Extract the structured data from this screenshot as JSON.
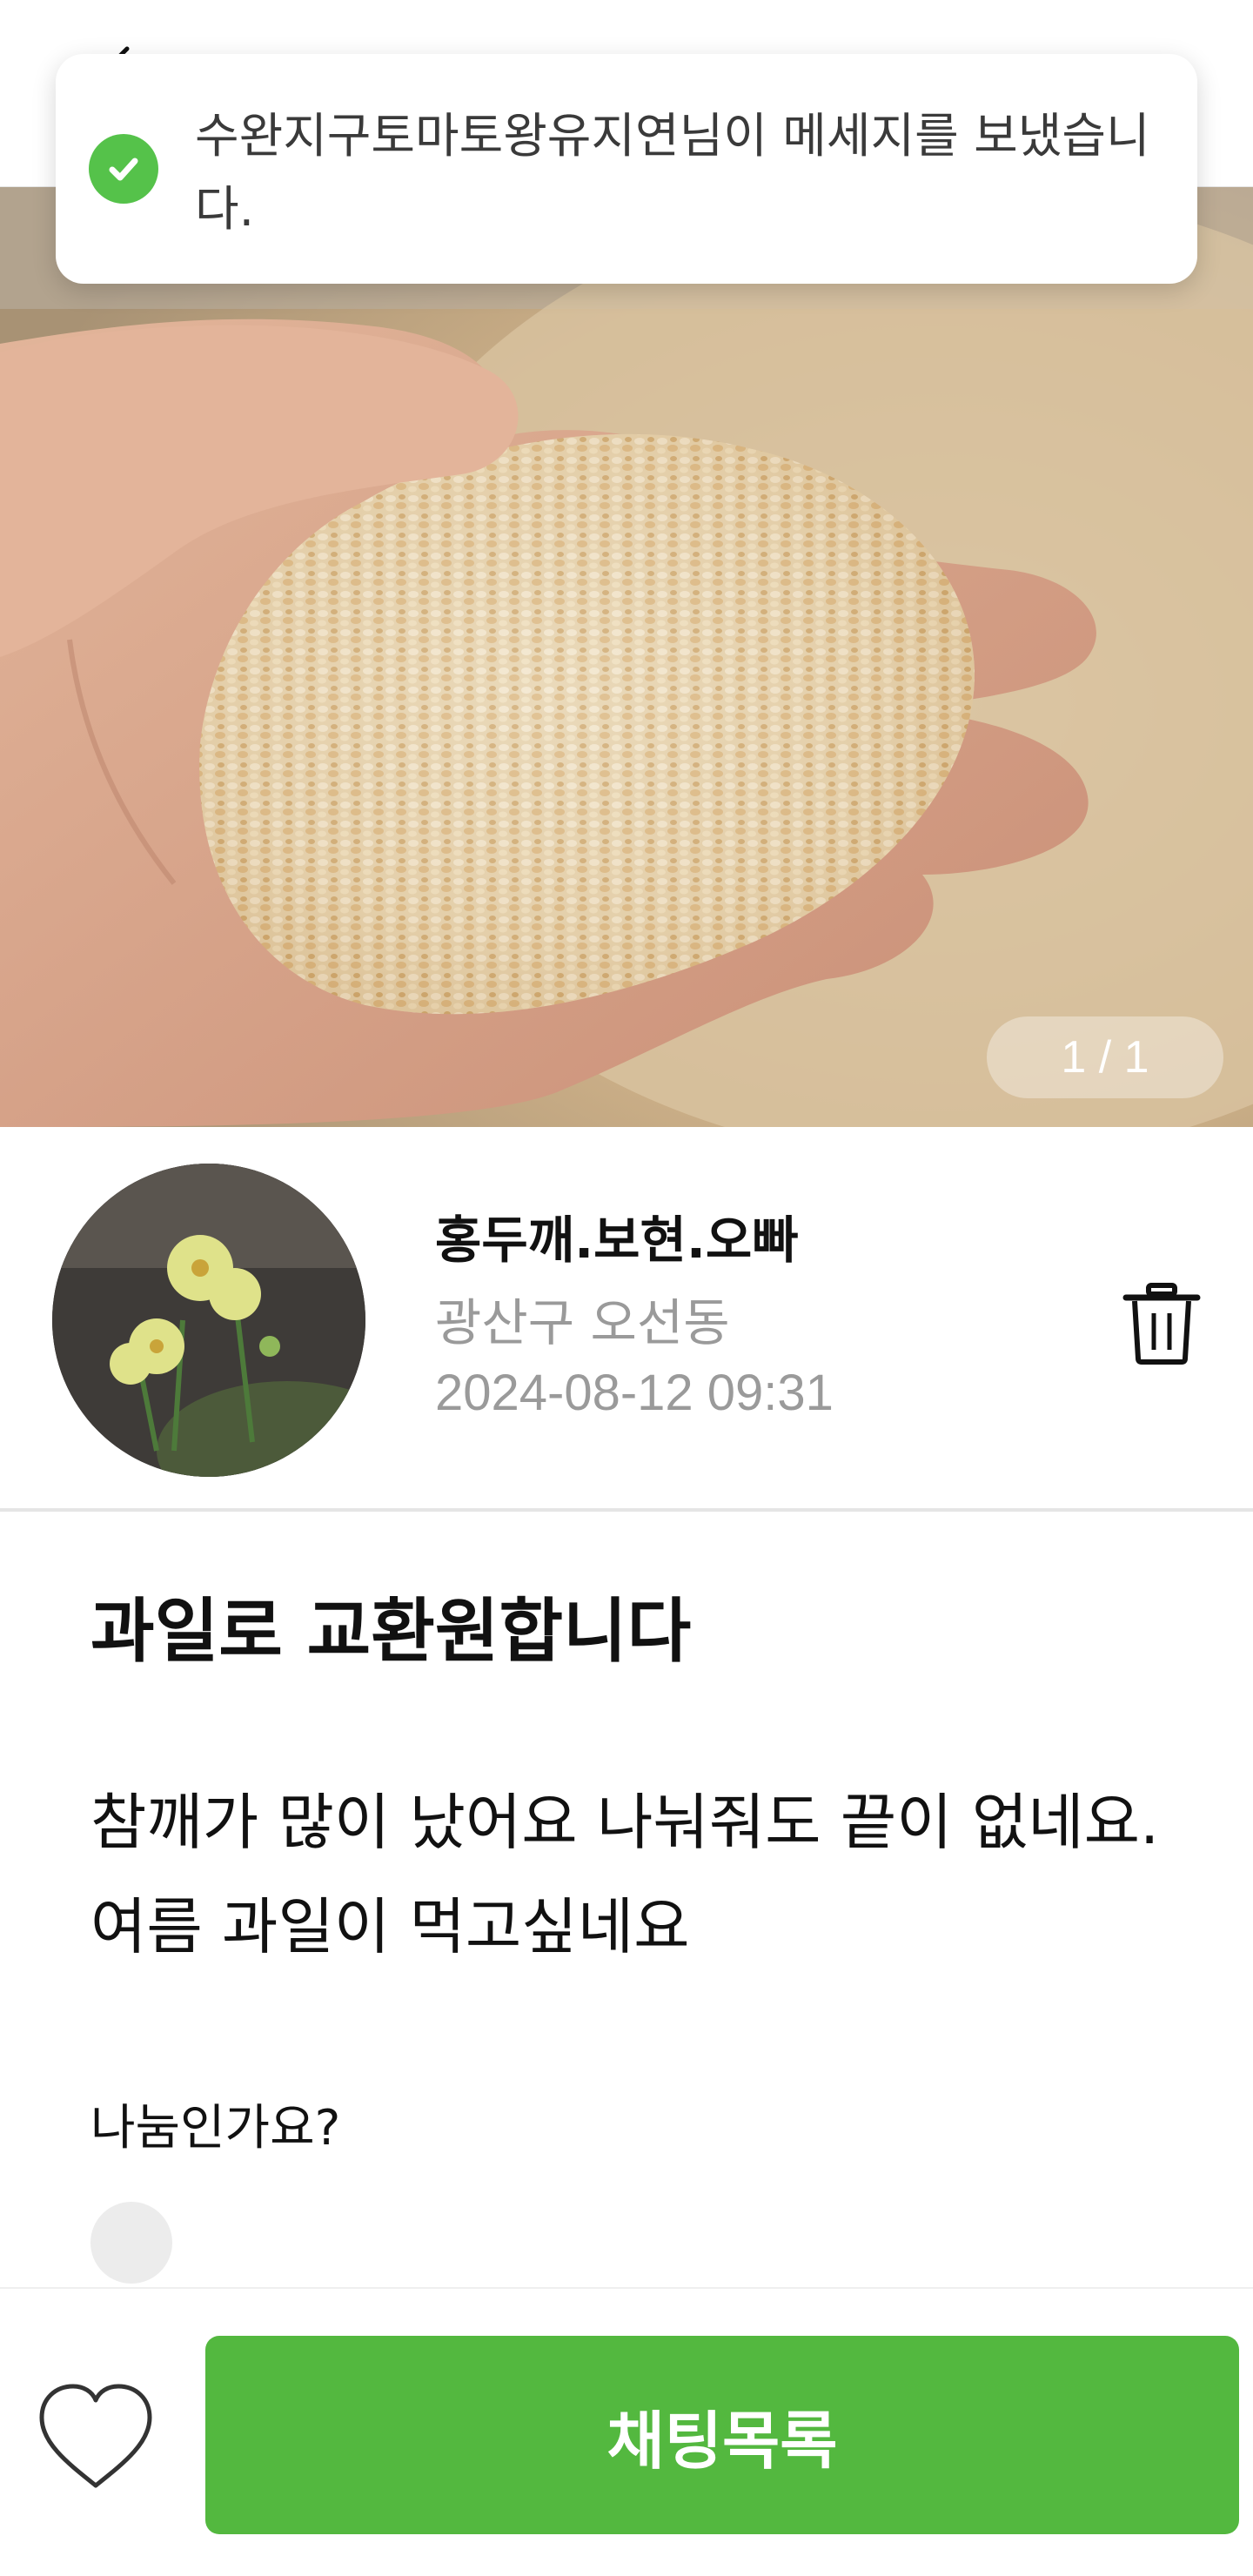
{
  "toast": {
    "message": "수완지구토마토왕유지연님이 메세지를 보냈습니다.",
    "icon": "check-circle-icon",
    "icon_color": "#55c24a"
  },
  "gallery": {
    "pager": "1 / 1"
  },
  "author": {
    "name": "홍두깨.보현.오빠",
    "location": "광산구 오선동",
    "date": "2024-08-12 09:31"
  },
  "post": {
    "title": "과일로 교환원합니다",
    "body": "참깨가 많이 났어요 나눠줘도 끝이 없네요.여름 과일이 먹고싶네요",
    "share_question": "나눔인가요?"
  },
  "actions": {
    "chat_label": "채팅목록",
    "accent": "#53b83f"
  }
}
